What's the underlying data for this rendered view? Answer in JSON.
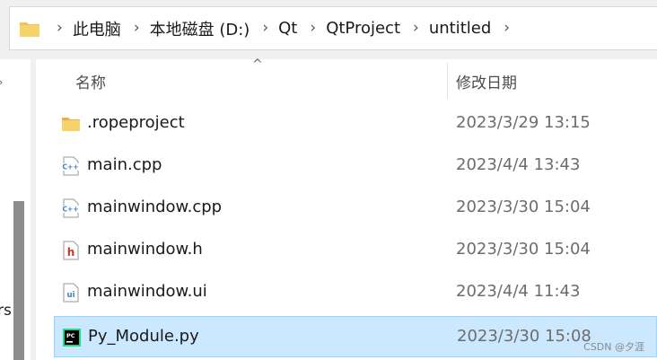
{
  "breadcrumb": {
    "items": [
      "此电脑",
      "本地磁盘 (D:)",
      "Qt",
      "QtProject",
      "untitled"
    ],
    "separator": "›"
  },
  "nav": {
    "chevron": "›",
    "partial_text": "rs"
  },
  "header": {
    "sort_indicator": "^",
    "name": "名称",
    "date": "修改日期"
  },
  "files": [
    {
      "name": ".ropeproject",
      "date": "2023/3/29 13:15",
      "icon": "folder-icon"
    },
    {
      "name": "main.cpp",
      "date": "2023/4/4 13:43",
      "icon": "cpp-file-icon",
      "badge": "C++"
    },
    {
      "name": "mainwindow.cpp",
      "date": "2023/3/30 15:04",
      "icon": "cpp-file-icon",
      "badge": "C++"
    },
    {
      "name": "mainwindow.h",
      "date": "2023/3/30 15:04",
      "icon": "header-file-icon",
      "badge": "h"
    },
    {
      "name": "mainwindow.ui",
      "date": "2023/4/4 11:43",
      "icon": "ui-file-icon",
      "badge": "ui"
    },
    {
      "name": "Py_Module.py",
      "date": "2023/3/30 15:08",
      "icon": "pycharm-file-icon",
      "badge": "PC",
      "selected": true
    }
  ],
  "watermark": "CSDN @夕涯",
  "colors": {
    "folder": "#f2c14e",
    "selection_bg": "#cce8ff",
    "selection_border": "#99d1ff",
    "cpp_badge": "#3f7fbf",
    "h_badge": "#c0392b",
    "ui_badge": "#3f7fbf",
    "pycharm_bg": "#000000",
    "pycharm_accent": "#21d789"
  }
}
